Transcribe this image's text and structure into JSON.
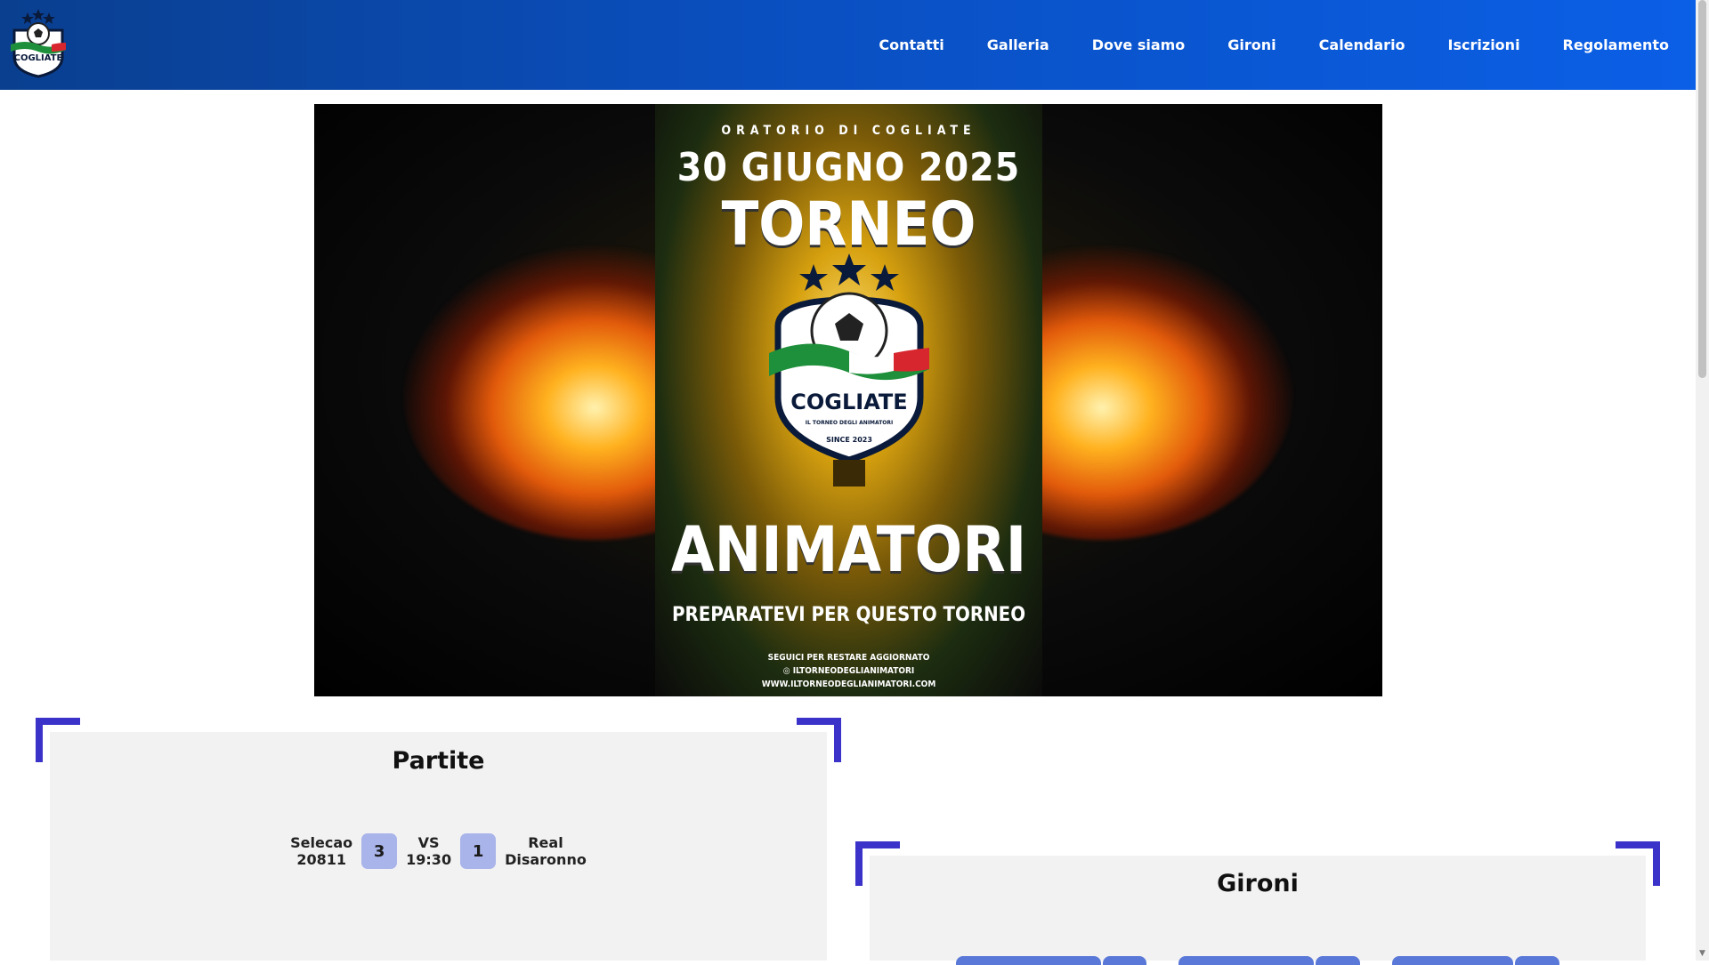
{
  "nav": {
    "items": [
      "Contatti",
      "Galleria",
      "Dove siamo",
      "Gironi",
      "Calendario",
      "Iscrizioni",
      "Regolamento"
    ]
  },
  "logo": {
    "text": "COGLIATE"
  },
  "banner": {
    "top_line": "ORATORIO DI COGLIATE",
    "date": "30 GIUGNO 2025",
    "title_1": "TORNEO",
    "badge_name": "COGLIATE",
    "badge_sub": "IL TORNEO DEGLI ANIMATORI",
    "badge_since": "SINCE 2023",
    "title_2": "ANIMATORI",
    "tagline": "PREPARATEVI PER QUESTO TORNEO",
    "follow": "SEGUICI PER RESTARE AGGIORNATO",
    "instagram": "◎ ILTORNEODEGLIANIMATORI",
    "website": "WWW.ILTORNEODEGLIANIMATORI.COM"
  },
  "partite": {
    "title": "Partite",
    "match": {
      "home_line1": "Selecao",
      "home_line2": "20811",
      "home_score": "3",
      "vs": "VS",
      "time": "19:30",
      "away_score": "1",
      "away_line1": "Real",
      "away_line2": "Disaronno"
    }
  },
  "gironi": {
    "title": "Gironi"
  },
  "colors": {
    "header": "#0a4fc0",
    "accent": "#3a32c9",
    "score_bg": "#a9b4ea"
  }
}
